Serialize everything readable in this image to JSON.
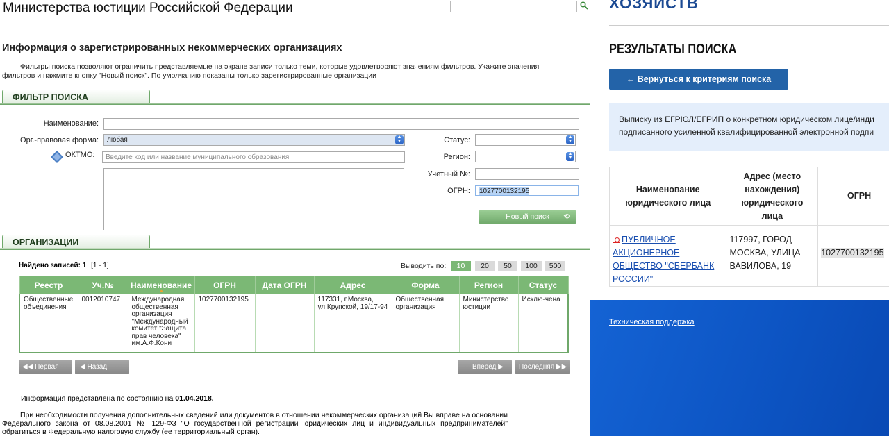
{
  "left": {
    "site_title": "Министерства юстиции Российской Федерации",
    "page_heading": "Информация о зарегистрированных некоммерческих организациях",
    "page_description": "Фильтры поиска позволяют ограничить представляемые на экране записи только теми, которые удовлетворяют значениям фильтров. Укажите значения фильтров и нажмите кнопку \"Новый поиск\". По умолчанию показаны только зарегистрированные организации",
    "filter_section_title": "ФИЛЬТР ПОИСКА",
    "filter": {
      "name_label": "Наименование:",
      "name_value": "",
      "org_form_label": "Орг.-правовая форма:",
      "org_form_value": "любая",
      "oktmo_label": "ОКТМО:",
      "oktmo_placeholder": "Введите код или название муниципального образования",
      "status_label": "Статус:",
      "status_value": "",
      "region_label": "Регион:",
      "region_value": "",
      "account_no_label": "Учетный №:",
      "account_no_value": "",
      "ogrn_label": "ОГРН:",
      "ogrn_value": "1027700132195",
      "new_search_label": "Новый поиск"
    },
    "orgs_section_title": "ОРГАНИЗАЦИИ",
    "found_label": "Найдено записей: 1",
    "found_range": "[1 - 1]",
    "per_page_label": "Выводить по:",
    "per_page_options": [
      "10",
      "20",
      "50",
      "100",
      "500"
    ],
    "per_page_selected": "10",
    "table": {
      "columns": [
        "Реестр",
        "Уч.№",
        "Наименование",
        "ОГРН",
        "Дата ОГРН",
        "Адрес",
        "Форма",
        "Регион",
        "Статус"
      ],
      "rows": [
        {
          "registry": "Общественные объединения",
          "account_no": "0012010747",
          "name": "Международная общественная организация \"Международный комитет \"Защита прав человека\" им.А.Ф.Кони",
          "ogrn": "1027700132195",
          "ogrn_date": "",
          "address": "117331, г.Москва, ул.Крупской, 19/17-94",
          "form": "Общественная организация",
          "region": "Министерство юстиции",
          "status": "Исклю-чена"
        }
      ]
    },
    "nav": {
      "first": "Первая",
      "prev": "Назад",
      "next": "Вперед",
      "last": "Последняя"
    },
    "info_date_prefix": "Информация представлена по состоянию на",
    "info_date": "01.04.2018.",
    "info_paragraph": "При необходимости получения дополнительных сведений или документов в отношении некоммерческих организаций Вы вправе на основании Федерального закона от 08.08.2001 № 129-ФЗ \"О государственной регистрации юридических лиц и индивидуальных предпринимателей\" обратиться в Федеральную налоговую службу (ее территориальный орган)."
  },
  "right": {
    "logo_text": "ХОЗЯЙСТВ",
    "results_title": "РЕЗУЛЬТАТЫ ПОИСКА",
    "back_button": "← Вернуться к критериям поиска",
    "notice_line1": "Выписку из ЕГРЮЛ/ЕГРИП о конкретном юридическом лице/инди",
    "notice_line2": "подписанного усиленной квалифицированной электронной подпи",
    "table": {
      "columns": [
        "Наименование юридического лица",
        "Адрес (место нахождения) юридического лица",
        "ОГРН"
      ],
      "rows": [
        {
          "name": "ПУБЛИЧНОЕ АКЦИОНЕРНОЕ ОБЩЕСТВО \"СБЕРБАНК РОССИИ\"",
          "address": "117997, ГОРОД МОСКВА, УЛИЦА ВАВИЛОВА, 19",
          "ogrn": "1027700132195"
        }
      ]
    },
    "support_link": "Техническая поддержка"
  },
  "colors": {
    "green": "#7bb875",
    "dark_blue": "#2363a8",
    "footer_blue": "#0d55c4",
    "notice_bg": "#e4eefb"
  }
}
